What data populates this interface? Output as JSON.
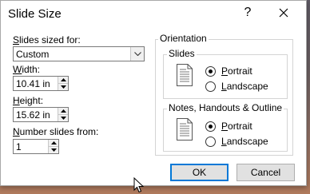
{
  "dialog": {
    "title": "Slide Size",
    "help_label": "?",
    "close_icon": "close-icon"
  },
  "left": {
    "slides_sized_for": {
      "label_u": "S",
      "label_rest": "lides sized for:",
      "value": "Custom"
    },
    "width": {
      "label_u": "W",
      "label_rest": "idth:",
      "value": "10.41 in"
    },
    "height": {
      "label_u": "H",
      "label_rest": "eight:",
      "value": "15.62 in"
    },
    "number_from": {
      "label_u": "N",
      "label_rest": "umber slides from:",
      "value": "1"
    }
  },
  "orientation": {
    "title": "Orientation",
    "slides": {
      "title": "Slides",
      "portrait_u": "P",
      "portrait_rest": "ortrait",
      "landscape_u": "L",
      "landscape_rest": "andscape",
      "selected": "portrait"
    },
    "notes": {
      "title": "Notes, Handouts & Outline",
      "portrait_u": "P",
      "portrait_rest": "ortrait",
      "landscape_u": "L",
      "landscape_rest": "andscape",
      "selected": "portrait"
    }
  },
  "buttons": {
    "ok": "OK",
    "cancel": "Cancel"
  },
  "colors": {
    "accent": "#0078d7",
    "button_face": "#e1e1e1"
  }
}
